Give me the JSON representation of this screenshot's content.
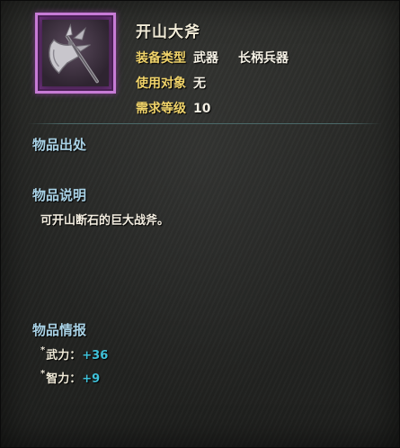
{
  "item": {
    "name": "开山大斧",
    "icon": "axe-icon",
    "rarity_color": "#c77bd6"
  },
  "attributes": [
    {
      "key": "装备类型",
      "value": "武器",
      "value2": "长柄兵器"
    },
    {
      "key": "使用对象",
      "value": "无"
    },
    {
      "key": "需求等级",
      "value": "10"
    }
  ],
  "sections": {
    "source_title": "物品出处",
    "desc_title": "物品说明",
    "description": "可开山断石的巨大战斧。",
    "intel_title": "物品情报"
  },
  "stats": [
    {
      "bullet": "*",
      "label": "武力：",
      "value": "+36"
    },
    {
      "bullet": "*",
      "label": "智力：",
      "value": "+9"
    }
  ],
  "colors": {
    "attr_key": "#f0d36a",
    "section_title": "#a9d2e6",
    "stat_value": "#3fc1d9"
  }
}
